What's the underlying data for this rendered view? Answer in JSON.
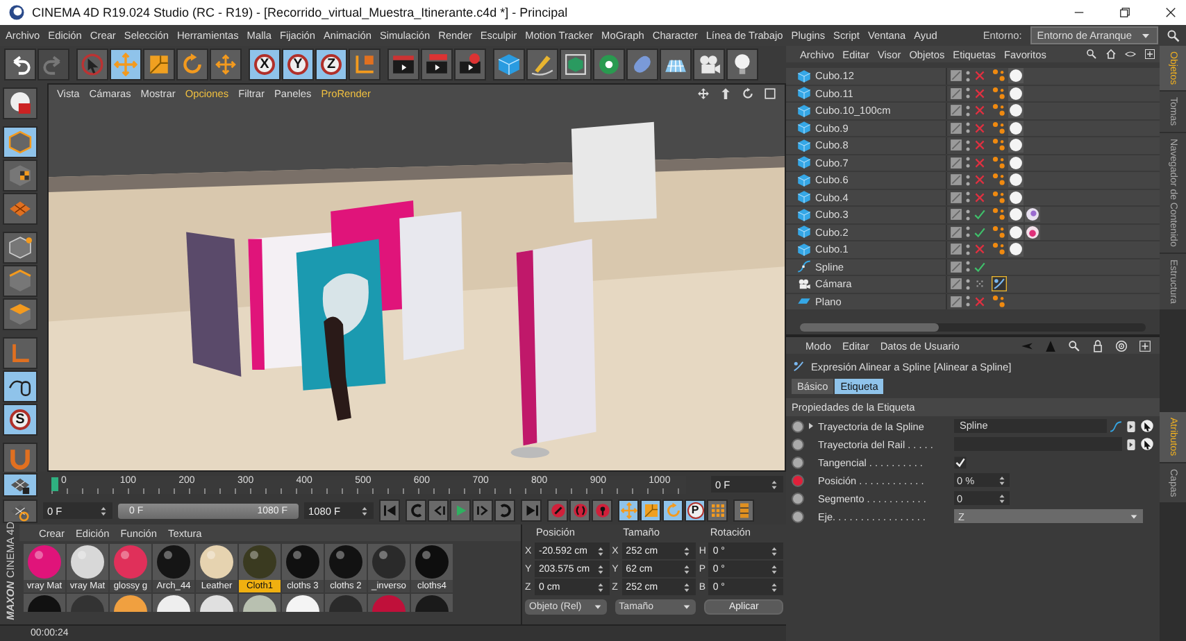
{
  "window": {
    "title": "CINEMA 4D R19.024 Studio (RC - R19) - [Recorrido_virtual_Muestra_Itinerante.c4d *] - Principal"
  },
  "menu": [
    "Archivo",
    "Edición",
    "Crear",
    "Selección",
    "Herramientas",
    "Malla",
    "Fijación",
    "Animación",
    "Simulación",
    "Render",
    "Esculpir",
    "Motion Tracker",
    "MoGraph",
    "Character",
    "Línea de Trabajo",
    "Plugins",
    "Script",
    "Ventana",
    "Ayud"
  ],
  "layout": {
    "label": "Entorno:",
    "value": "Entorno de Arranque"
  },
  "toolbar": [
    [
      {
        "kind": "undo",
        "selected": false,
        "disabled": false
      },
      {
        "kind": "redo",
        "selected": false,
        "disabled": true
      }
    ],
    [
      {
        "kind": "select",
        "selected": false,
        "disabled": false
      },
      {
        "kind": "move",
        "selected": true,
        "disabled": false
      },
      {
        "kind": "scale",
        "selected": false,
        "disabled": false
      },
      {
        "kind": "rotate",
        "selected": false,
        "disabled": false
      },
      {
        "kind": "transform",
        "selected": false,
        "disabled": false
      }
    ],
    [
      {
        "kind": "axis",
        "label": "X",
        "selected": true,
        "disabled": false
      },
      {
        "kind": "axis",
        "label": "Y",
        "selected": true,
        "disabled": false
      },
      {
        "kind": "axis",
        "label": "Z",
        "selected": true,
        "disabled": false
      },
      {
        "kind": "coord",
        "selected": false,
        "disabled": false
      }
    ],
    [
      {
        "kind": "renderview",
        "selected": false,
        "disabled": false
      },
      {
        "kind": "render",
        "selected": false,
        "disabled": false
      },
      {
        "kind": "rendersettings",
        "selected": false,
        "disabled": false
      }
    ],
    [
      {
        "kind": "cube",
        "selected": false,
        "disabled": false
      },
      {
        "kind": "pen",
        "selected": false,
        "disabled": false
      },
      {
        "kind": "subdiv",
        "selected": false,
        "disabled": false
      },
      {
        "kind": "mograph",
        "selected": false,
        "disabled": false
      },
      {
        "kind": "deformer",
        "selected": false,
        "disabled": false
      },
      {
        "kind": "floor",
        "selected": false,
        "disabled": false
      },
      {
        "kind": "camera",
        "selected": false,
        "disabled": false
      },
      {
        "kind": "light",
        "selected": false,
        "disabled": false
      }
    ]
  ],
  "left_tools": [
    [
      {
        "kind": "scene",
        "selected": false
      }
    ],
    [
      {
        "kind": "model",
        "selected": true
      },
      {
        "kind": "texture",
        "selected": false
      },
      {
        "kind": "workplane",
        "selected": false
      }
    ],
    [
      {
        "kind": "points",
        "selected": false
      },
      {
        "kind": "edges",
        "selected": false
      },
      {
        "kind": "polygons",
        "selected": false
      }
    ],
    [
      {
        "kind": "axismode",
        "selected": false
      },
      {
        "kind": "tweak",
        "selected": true
      },
      {
        "kind": "snap",
        "label": "S",
        "selected": true
      }
    ],
    [
      {
        "kind": "magnet",
        "selected": false
      }
    ]
  ],
  "viewport": {
    "menu": [
      {
        "label": "Vista",
        "highlighted": false
      },
      {
        "label": "Cámaras",
        "highlighted": false
      },
      {
        "label": "Mostrar",
        "highlighted": false
      },
      {
        "label": "Opciones",
        "highlighted": true
      },
      {
        "label": "Filtrar",
        "highlighted": false
      },
      {
        "label": "Paneles",
        "highlighted": false
      },
      {
        "label": "ProRender",
        "highlighted": true
      }
    ]
  },
  "timeline": {
    "ticks": [
      "0",
      "100",
      "200",
      "300",
      "400",
      "500",
      "600",
      "700",
      "800",
      "900",
      "1000"
    ],
    "level": 0,
    "current": "0 F",
    "tools": [
      {
        "kind": "lockgrid",
        "selected": true
      },
      {
        "kind": "wpgrid",
        "selected": false
      }
    ]
  },
  "transport": {
    "start": "0 F",
    "range": {
      "start": "0 F",
      "end": "1080 F",
      "level": 1
    },
    "end": "1080 F",
    "buttons": [
      [
        {
          "kind": "skipstart",
          "selected": false
        }
      ],
      [
        {
          "kind": "loopstart",
          "selected": false
        },
        {
          "kind": "prev",
          "selected": false
        },
        {
          "kind": "play",
          "selected": false
        },
        {
          "kind": "next",
          "selected": false
        },
        {
          "kind": "loopend",
          "selected": false
        }
      ],
      [
        {
          "kind": "skipend",
          "selected": false
        }
      ],
      [
        {
          "kind": "rec",
          "selected": false
        },
        {
          "kind": "auto",
          "selected": false
        },
        {
          "kind": "keyset",
          "selected": false
        }
      ],
      [
        {
          "kind": "move",
          "selected": true
        },
        {
          "kind": "scale",
          "selected": true
        },
        {
          "kind": "rotate",
          "selected": true
        },
        {
          "kind": "param",
          "label": "P",
          "selected": true
        },
        {
          "kind": "dots",
          "selected": false
        }
      ],
      [
        {
          "kind": "timelinewin",
          "selected": false
        }
      ]
    ]
  },
  "materials": {
    "menu": [
      "Crear",
      "Edición",
      "Función",
      "Textura"
    ],
    "items": [
      {
        "name": "vray Mat",
        "color": "#e0147a",
        "selected": false
      },
      {
        "name": "vray Mat",
        "color": "#d8d8d8",
        "selected": false
      },
      {
        "name": "glossy g",
        "color": "#e0305a",
        "selected": false
      },
      {
        "name": "Arch_44",
        "color": "#151515",
        "selected": false
      },
      {
        "name": "Leather",
        "color": "#e6d3b0",
        "selected": false
      },
      {
        "name": "Cloth1",
        "color": "#3a3a20",
        "selected": true
      },
      {
        "name": "cloths 3",
        "color": "#101010",
        "selected": false
      },
      {
        "name": "cloths 2",
        "color": "#121212",
        "selected": false
      },
      {
        "name": "_inverso",
        "color": "#2a2a2a",
        "selected": false
      },
      {
        "name": "cloths4",
        "color": "#0e0e0e",
        "selected": false
      }
    ],
    "more": [
      {
        "color": "#111111"
      },
      {
        "color": "#333333"
      },
      {
        "color": "#f0a040"
      },
      {
        "color": "#eeeeee"
      },
      {
        "color": "#e0e0e0"
      },
      {
        "color": "#b8c0b0"
      },
      {
        "color": "#f4f4f4"
      },
      {
        "color": "#2a2a2a"
      },
      {
        "color": "#c0103a"
      },
      {
        "color": "#1a1a1a"
      }
    ]
  },
  "logo": [
    "MAXON",
    "CINEMA 4D"
  ],
  "coordinates": {
    "columns": [
      {
        "title": "Posición",
        "fields": [
          {
            "axis": "X",
            "value": "-20.592 cm"
          },
          {
            "axis": "Y",
            "value": "203.575 cm"
          },
          {
            "axis": "Z",
            "value": "0 cm"
          }
        ]
      },
      {
        "title": "Tamaño",
        "fields": [
          {
            "axis": "X",
            "value": "252 cm"
          },
          {
            "axis": "Y",
            "value": "62 cm"
          },
          {
            "axis": "Z",
            "value": "252 cm"
          }
        ]
      },
      {
        "title": "Rotación",
        "fields": [
          {
            "axis": "H",
            "value": "0 °"
          },
          {
            "axis": "P",
            "value": "0 °"
          },
          {
            "axis": "B",
            "value": "0 °"
          }
        ]
      }
    ],
    "mode": "Objeto (Rel)",
    "size_mode": "Tamaño",
    "apply": "Aplicar"
  },
  "status_bar": "00:00:24",
  "objects": {
    "menu": [
      "Archivo",
      "Editar",
      "Visor",
      "Objetos",
      "Etiquetas",
      "Favoritos"
    ],
    "items": [
      {
        "name": "Cubo.12",
        "kind": "cube",
        "render": {
          "kind": "off"
        },
        "tags": [
          {
            "kind": "phong"
          },
          {
            "kind": "material"
          }
        ]
      },
      {
        "name": "Cubo.11",
        "kind": "cube",
        "render": {
          "kind": "off"
        },
        "tags": [
          {
            "kind": "phong"
          },
          {
            "kind": "material"
          }
        ]
      },
      {
        "name": "Cubo.10_100cm",
        "kind": "cube",
        "render": {
          "kind": "off"
        },
        "tags": [
          {
            "kind": "phong"
          },
          {
            "kind": "material"
          }
        ]
      },
      {
        "name": "Cubo.9",
        "kind": "cube",
        "render": {
          "kind": "off"
        },
        "tags": [
          {
            "kind": "phong"
          },
          {
            "kind": "material"
          }
        ]
      },
      {
        "name": "Cubo.8",
        "kind": "cube",
        "render": {
          "kind": "off"
        },
        "tags": [
          {
            "kind": "phong"
          },
          {
            "kind": "material"
          }
        ]
      },
      {
        "name": "Cubo.7",
        "kind": "cube",
        "render": {
          "kind": "off"
        },
        "tags": [
          {
            "kind": "phong"
          },
          {
            "kind": "material"
          }
        ]
      },
      {
        "name": "Cubo.6",
        "kind": "cube",
        "render": {
          "kind": "off"
        },
        "tags": [
          {
            "kind": "phong"
          },
          {
            "kind": "material"
          }
        ]
      },
      {
        "name": "Cubo.4",
        "kind": "cube",
        "render": {
          "kind": "off"
        },
        "tags": [
          {
            "kind": "phong"
          },
          {
            "kind": "material"
          }
        ]
      },
      {
        "name": "Cubo.3",
        "kind": "cube",
        "render": {
          "kind": "on"
        },
        "tags": [
          {
            "kind": "phong"
          },
          {
            "kind": "material"
          },
          {
            "kind": "decal_violet"
          }
        ]
      },
      {
        "name": "Cubo.2",
        "kind": "cube",
        "render": {
          "kind": "on"
        },
        "tags": [
          {
            "kind": "phong"
          },
          {
            "kind": "material"
          },
          {
            "kind": "decal_pink"
          }
        ]
      },
      {
        "name": "Cubo.1",
        "kind": "cube",
        "render": {
          "kind": "off"
        },
        "tags": [
          {
            "kind": "phong"
          },
          {
            "kind": "material"
          }
        ]
      },
      {
        "name": "Spline",
        "kind": "spline",
        "render": {
          "kind": "on"
        }
      },
      {
        "name": "Cámara",
        "kind": "camera",
        "render": {
          "kind": "default"
        },
        "tags": [
          {
            "kind": "align"
          }
        ]
      },
      {
        "name": "Plano",
        "kind": "plane",
        "render": {
          "kind": "off"
        },
        "tags": [
          {
            "kind": "phong"
          }
        ]
      }
    ]
  },
  "attributes": {
    "menu": [
      "Modo",
      "Editar",
      "Datos de Usuario"
    ],
    "title": "Expresión Alinear a Spline  [Alinear a Spline]",
    "tabs": [
      {
        "label": "Básico",
        "selected": false
      },
      {
        "label": "Etiqueta",
        "selected": true
      }
    ],
    "section": "Propiedades de la Etiqueta",
    "fields": [
      {
        "kind": "link",
        "label": "Trayectoria de la Spline",
        "value": "Spline",
        "animated": false,
        "expandable": true
      },
      {
        "kind": "link",
        "label": "Trayectoria del Rail . . . . .",
        "animated": false,
        "expandable": false
      },
      {
        "kind": "checkbox",
        "label": "Tangencial . . . . . . . . . .",
        "checked": true,
        "animated": false,
        "expandable": false
      },
      {
        "kind": "number",
        "label": "Posición . . . . . . . . . . . .",
        "value": "0 %",
        "animated": true,
        "expandable": false
      },
      {
        "kind": "number",
        "label": "Segmento . . . . . . . . . . .",
        "value": "0",
        "animated": false,
        "expandable": false
      },
      {
        "kind": "dropdown",
        "label": "Eje. . . . . . . . . . . . . . . . .",
        "value": "Z",
        "animated": false,
        "expandable": false
      }
    ]
  },
  "side_tabs": {
    "top": [
      {
        "label": "Objetos",
        "selected": true
      },
      {
        "label": "Tomas",
        "selected": false
      },
      {
        "label": "Navegador de Contenido",
        "selected": false
      },
      {
        "label": "Estructura",
        "selected": false
      }
    ],
    "bottom": [
      {
        "label": "Atributos",
        "selected": true
      },
      {
        "label": "Capas",
        "selected": false
      }
    ]
  }
}
